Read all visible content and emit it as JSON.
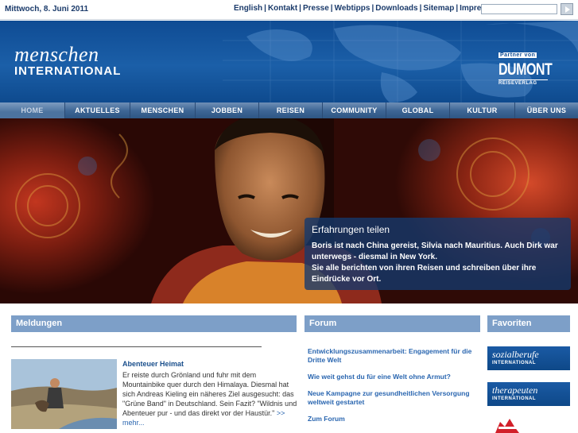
{
  "topbar": {
    "date": "Mittwoch, 8. Juni 2011",
    "links": [
      "English",
      "Kontakt",
      "Presse",
      "Webtipps",
      "Downloads",
      "Sitemap",
      "Impressum"
    ],
    "search_placeholder": ""
  },
  "header": {
    "logo_line1": "menschen",
    "logo_line2": "INTERNATIONAL",
    "partner_line1": "Partner von",
    "partner_line2": "DUMONT",
    "partner_line3": "REISEVERLAG"
  },
  "nav": {
    "items": [
      "HOME",
      "AKTUELLES",
      "MENSCHEN",
      "JOBBEN",
      "REISEN",
      "COMMUNITY",
      "GLOBAL",
      "KULTUR",
      "ÜBER UNS"
    ],
    "active_index": 0
  },
  "hero": {
    "title": "Erfahrungen teilen",
    "line1": "Boris ist nach China gereist, Silvia nach Mauritius. Auch Dirk war unterwegs - diesmal in New York.",
    "line2": "Sie alle berichten von ihren Reisen und schreiben über ihre Eindrücke vor Ort."
  },
  "meldungen": {
    "heading": "Meldungen",
    "news_title": "Abenteuer Heimat",
    "news_text": "Er reiste durch Grönland und fuhr mit dem Mountainbike quer durch den Himalaya. Diesmal hat sich Andreas Kieling ein näheres Ziel ausgesucht: das \"Grüne Band\" in Deutschland. Sein Fazit? \"Wildnis und Abenteuer pur - und das direkt vor der Haustür.\"",
    "more_label": ">> mehr..."
  },
  "forum": {
    "heading": "Forum",
    "links": [
      "Entwicklungszusammenarbeit: Engagement für die Dritte Welt",
      "Wie weit gehst du für eine Welt ohne Armut?",
      "Neue Kampagne zur gesundheitlichen Versorgung weltweit gestartet",
      "Zum Forum"
    ]
  },
  "favoriten": {
    "heading": "Favoriten",
    "items": [
      {
        "line1": "sozialberufe",
        "line2": "INTERNATIONAL"
      },
      {
        "line1": "therapeuten",
        "line2": "INTERNATIONAL"
      }
    ]
  },
  "colors": {
    "header_blue": "#1b5fa8",
    "column_head": "#7d9fc8",
    "link_blue": "#2a66b0"
  }
}
